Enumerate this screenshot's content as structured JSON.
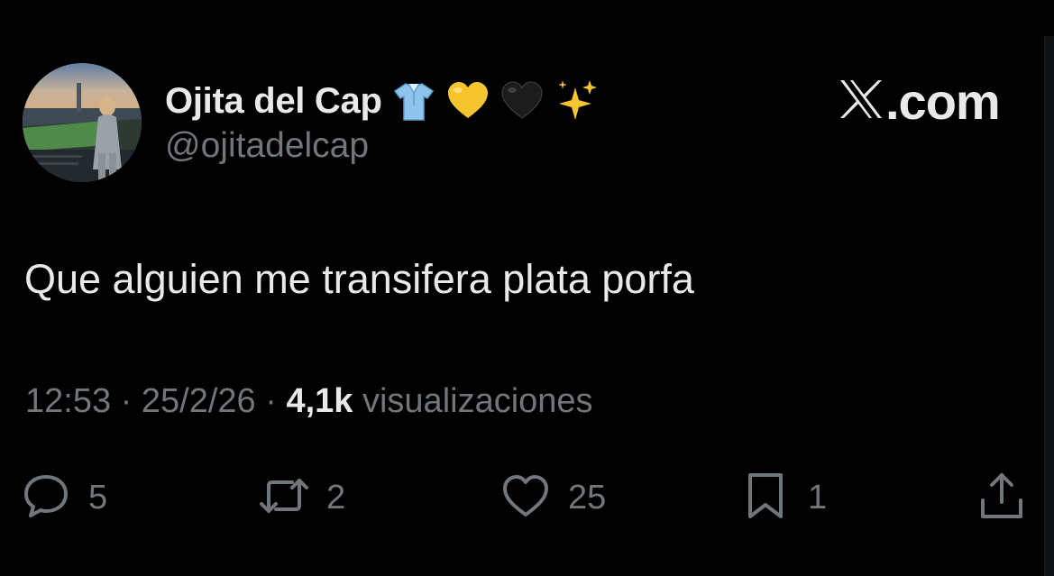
{
  "author": {
    "display_name": "Ojita del Cap",
    "handle": "@ojitadelcap",
    "name_emojis": [
      "shirt-emoji",
      "yellow-heart-emoji",
      "black-heart-emoji",
      "sparkles-emoji"
    ]
  },
  "brand": {
    "text": ".com",
    "logo_icon": "x-logo-icon"
  },
  "tweet": {
    "text": "Que alguien me transifera plata porfa",
    "time": "12:53",
    "date": "25/2/26",
    "separator": "·",
    "views_count": "4,1k",
    "views_label": "visualizaciones"
  },
  "actions": {
    "replies": "5",
    "reposts": "2",
    "likes": "25",
    "bookmarks": "1"
  },
  "colors": {
    "background": "#000000",
    "primary_text": "#e7e9ea",
    "secondary_text": "#71767b"
  }
}
